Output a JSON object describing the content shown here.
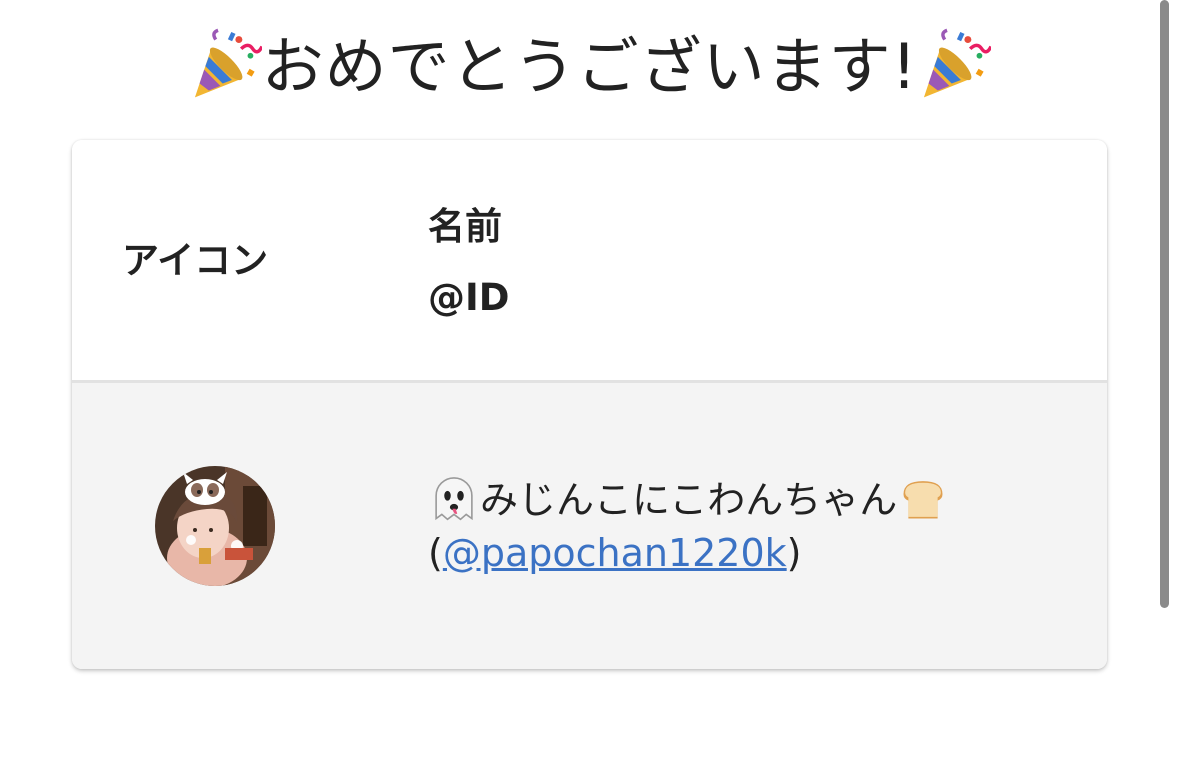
{
  "heading": {
    "text": "おめでとうございます!",
    "left_icon": "party-popper-icon",
    "right_icon": "party-popper-icon"
  },
  "table": {
    "headers": {
      "icon": "アイコン",
      "name": "名前",
      "id": "@ID"
    },
    "rows": [
      {
        "avatar": "user-avatar",
        "name_prefix_icon": "ghost-icon",
        "name": "みじんこにこわんちゃん",
        "name_suffix_icon": "bread-icon",
        "id_open": "(",
        "id": "@papochan1220k",
        "id_close": ")"
      }
    ]
  },
  "colors": {
    "link": "#3b72c4",
    "row_bg": "#f4f4f4",
    "divider": "#e2e2e2"
  }
}
